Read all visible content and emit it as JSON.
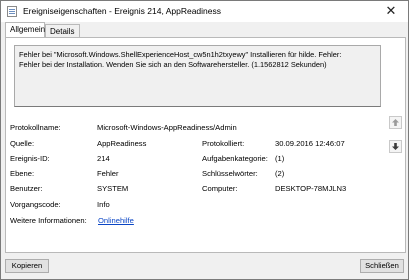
{
  "window": {
    "title": "Ereigniseigenschaften - Ereignis 214, AppReadiness",
    "close_glyph": "✕"
  },
  "tabs": [
    {
      "label": "Allgemein",
      "active": true
    },
    {
      "label": "Details",
      "active": false
    }
  ],
  "description": {
    "line1": "Fehler bei \"Microsoft.Windows.ShellExperienceHost_cw5n1h2txyewy\" Installieren für hilde. Fehler:",
    "line2": "Fehler bei der Installation. Wenden Sie sich an den Softwarehersteller. (1.1562812 Sekunden)"
  },
  "fields": {
    "log_name_label": "Protokollname:",
    "log_name_value": "Microsoft-Windows-AppReadiness/Admin",
    "source_label": "Quelle:",
    "source_value": "AppReadiness",
    "logged_label": "Protokolliert:",
    "logged_value": "30.09.2016 12:46:07",
    "event_id_label": "Ereignis-ID:",
    "event_id_value": "214",
    "task_category_label": "Aufgabenkategorie:",
    "task_category_value": "(1)",
    "level_label": "Ebene:",
    "level_value": "Fehler",
    "keywords_label": "Schlüsselwörter:",
    "keywords_value": "(2)",
    "user_label": "Benutzer:",
    "user_value": "SYSTEM",
    "computer_label": "Computer:",
    "computer_value": "DESKTOP-78MJLN3",
    "opcode_label": "Vorgangscode:",
    "opcode_value": "Info",
    "more_info_label": "Weitere Informationen:",
    "more_info_link": "Onlinehilfe"
  },
  "buttons": {
    "copy": "Kopieren",
    "close": "Schließen"
  },
  "icons": {
    "up": "arrow-up-icon",
    "down": "arrow-down-icon",
    "title": "event-log-icon"
  },
  "colors": {
    "link": "#0b46c5",
    "dialog_bg": "#f0f0f0"
  }
}
